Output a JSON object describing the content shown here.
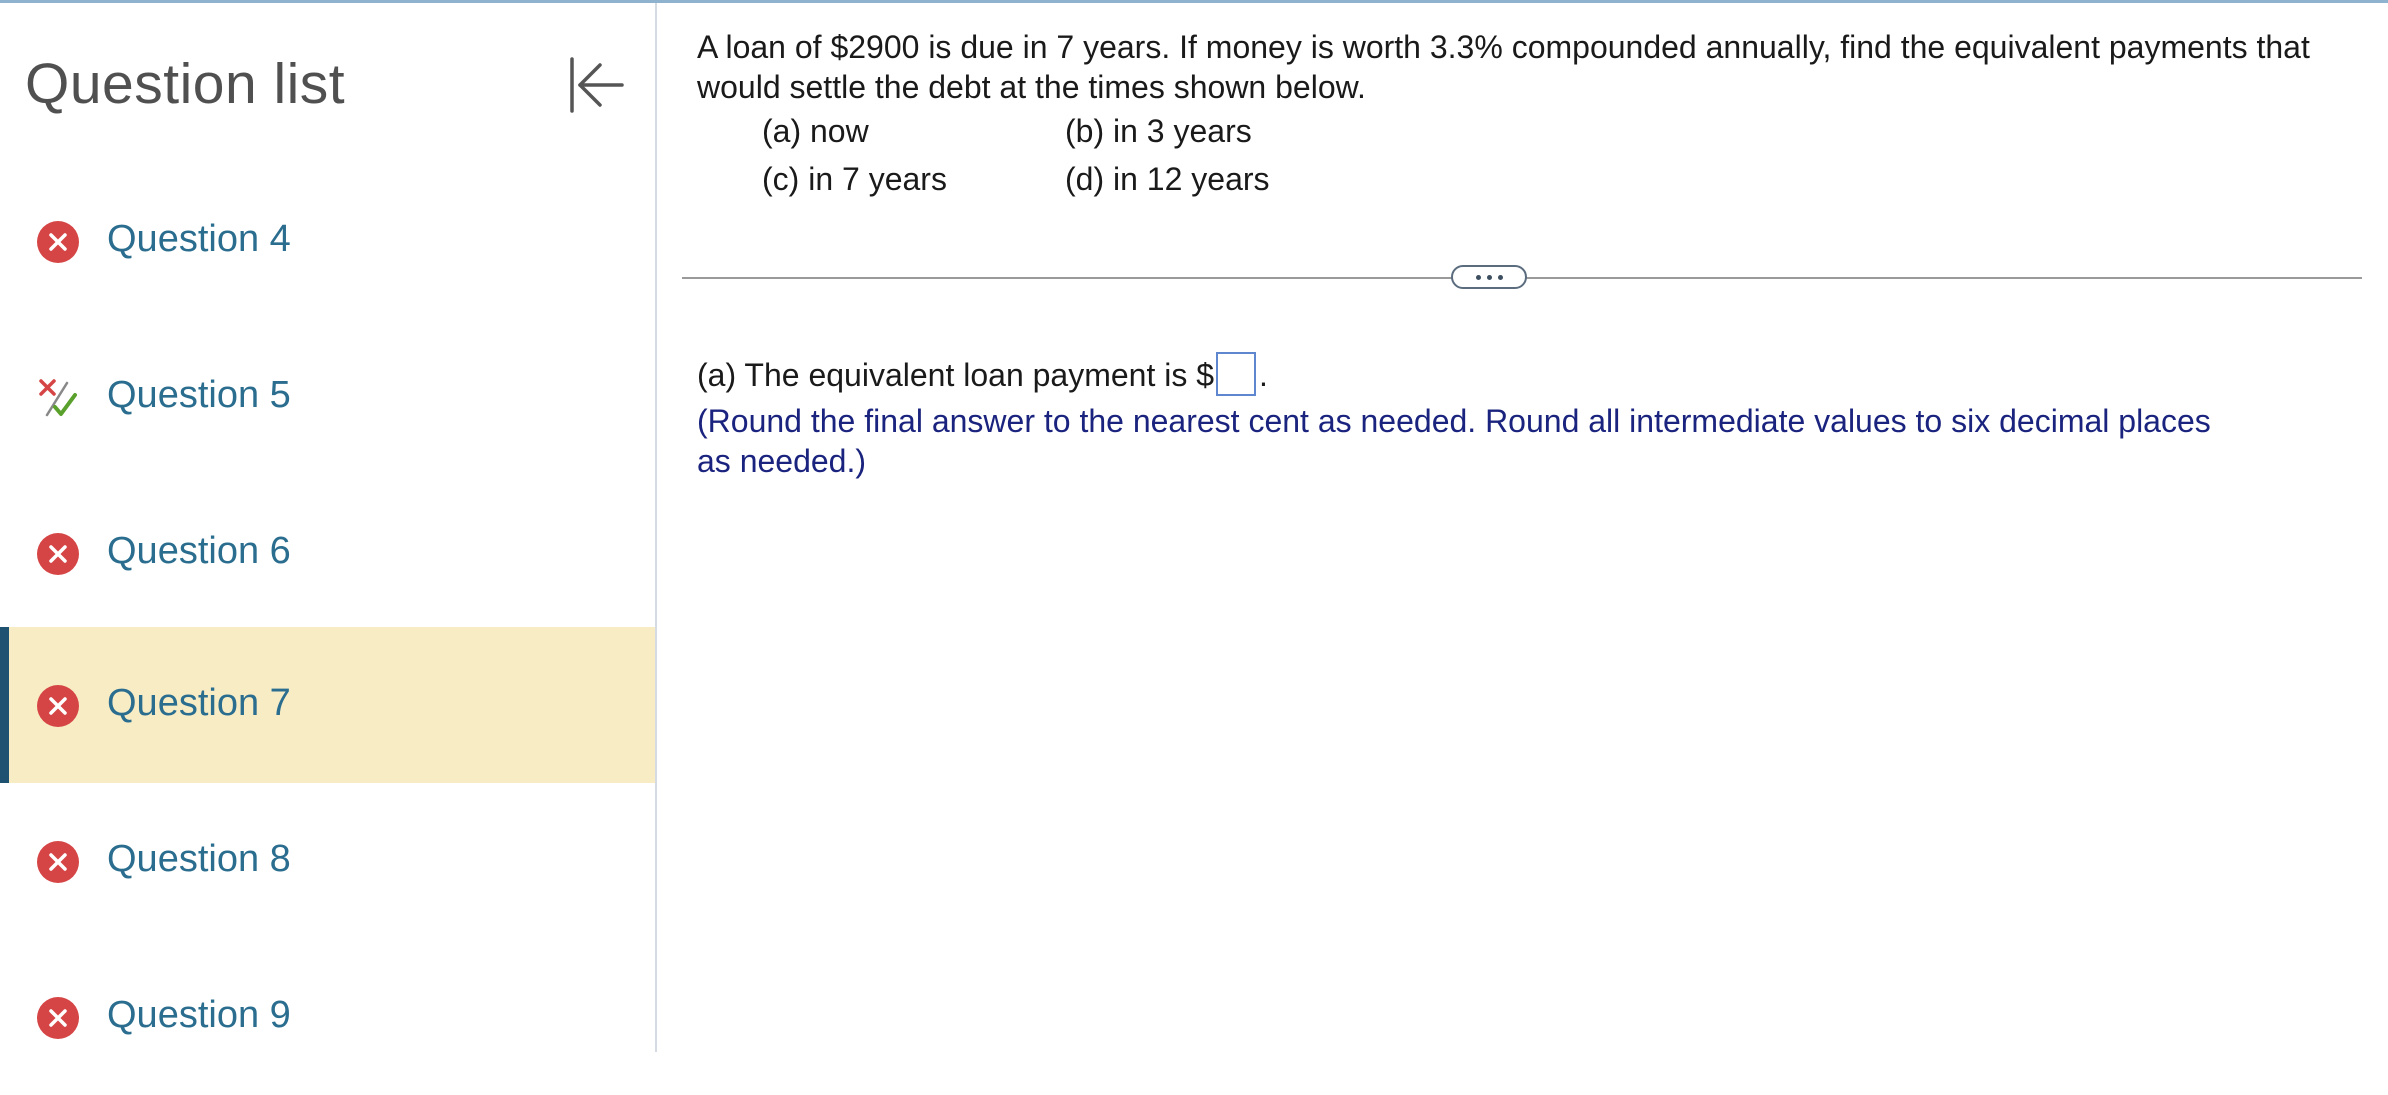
{
  "sidebar": {
    "title": "Question list",
    "collapse_icon": "collapse-left-icon",
    "items": [
      {
        "label": "Question 4",
        "status": "incorrect"
      },
      {
        "label": "Question 5",
        "status": "partial"
      },
      {
        "label": "Question 6",
        "status": "incorrect"
      },
      {
        "label": "Question 7",
        "status": "incorrect",
        "active": true
      },
      {
        "label": "Question 8",
        "status": "incorrect"
      },
      {
        "label": "Question 9",
        "status": "incorrect"
      }
    ]
  },
  "question": {
    "text": "A loan of $2900 is due in 7 years. If money is worth 3.3% compounded annually, find the equivalent payments that would settle the debt at the times shown below.",
    "options": {
      "a": "(a) now",
      "b": "(b) in 3 years",
      "c": "(c) in 7 years",
      "d": "(d) in 12 years"
    }
  },
  "answer": {
    "prefix": "(a) The equivalent loan payment is $",
    "value": "",
    "suffix": ".",
    "instruction": "(Round the final answer to the nearest cent as needed. Round all intermediate values to six decimal places as needed.)"
  },
  "colors": {
    "incorrect": "#d64545",
    "partial_check": "#5aa02c",
    "link": "#2a6d8f",
    "active_bg": "#f8ecc5",
    "active_bar": "#1f5270",
    "instruction": "#1a237e"
  }
}
